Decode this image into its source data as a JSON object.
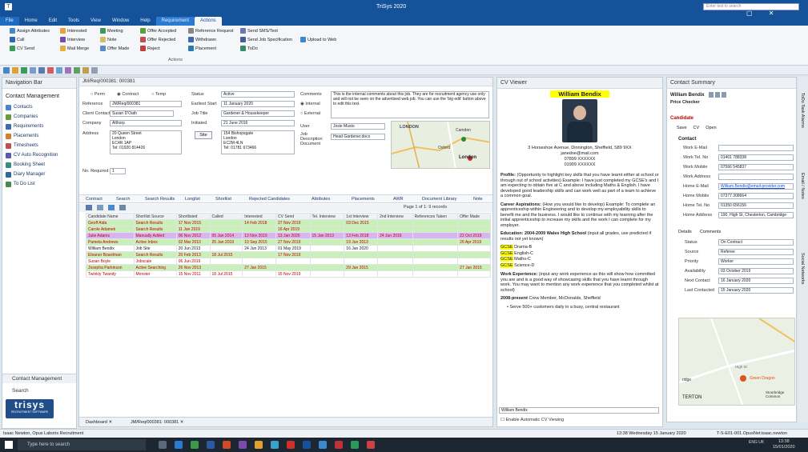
{
  "window": {
    "title": "TriSys 2020",
    "search_placeholder": "Enter text to search"
  },
  "ribbon_tabs": [
    "File",
    "Home",
    "Edit",
    "Tools",
    "View",
    "Window",
    "Help",
    "Requirement",
    "Actions"
  ],
  "ribbon": {
    "group_label": "Actions",
    "buttons": [
      "Assign Attributes",
      "Interested",
      "Meeting",
      "Offer Accepted",
      "Reference Request",
      "Send SMS/Text",
      "Call",
      "Interview",
      "Note",
      "Offer Rejected",
      "Withdrawn",
      "Send Job Specification",
      "Upload to Web",
      "CV Send",
      "Mail Merge",
      "Offer Made",
      "Reject",
      "Placement",
      "ToDo"
    ]
  },
  "nav": {
    "title": "Navigation Bar",
    "section": "Contact Management",
    "items": [
      "Contacts",
      "Companies",
      "Requirements",
      "Placements",
      "Timesheets",
      "CV Auto Recognition",
      "Booking Sheet",
      "Diary Manager",
      "To Do List"
    ],
    "bottom_items": [
      "Contact Management",
      "Search"
    ],
    "logo": "trisys",
    "logo_sub": "RECRUITMENT SOFTWARE"
  },
  "req": {
    "tab_title": "JM/Req/000381: 000381",
    "type_options": [
      "Perm",
      "Contract",
      "Temp"
    ],
    "labels": {
      "reference": "Reference",
      "client_contact": "Client Contact",
      "company": "Company",
      "address": "Address",
      "no_required": "No. Required",
      "status": "Status",
      "earliest_start": "Earliest Start",
      "job_title": "Job Title",
      "initiated": "Initiated",
      "site": "Site",
      "comments": "Comments",
      "user": "User",
      "job_description": "Job Description Document"
    },
    "reference": "JM/Req/000381",
    "client_contact": "Susan D'Oath",
    "company": "Althorp",
    "address": [
      "20 Queen Street",
      "London",
      "EC4R 1AP",
      "Tel: 01920 814426"
    ],
    "no_required": "1",
    "status": "Active",
    "earliest_start": "11 January 2020",
    "job_title": "Gardener & Housekeeper",
    "initiated": "21 June 2016",
    "site_address": [
      "154 Bishopsgate",
      "London",
      "EC2M 4LN",
      "Tel: 01781 673466"
    ],
    "comments": "This is the internal comments about this job. They are for recruitment agency use only and will not be seen on the advertised web job. You can use the 'big edit' button above to edit this text.",
    "comment_options": [
      "Internal",
      "External"
    ],
    "user": "Josie Musto",
    "job_doc": "Head Gardener.docx",
    "map_labels": [
      "LONDON",
      "Camden",
      "Oxford",
      "London"
    ]
  },
  "subtabs": [
    "Contract",
    "Search",
    "Search Results",
    "Longlist",
    "Shortlist",
    "Rejected Candidates",
    "Attributes",
    "Placements",
    "AWR",
    "Document Library",
    "Note"
  ],
  "grid": {
    "page_info": "Page 1 of 1: 9 records",
    "columns": [
      "Candidate Name",
      "Shortlist Source",
      "Shortlisted",
      "Called",
      "Interested",
      "CV Send",
      "Tel. Interview",
      "1st Interview",
      "2nd Interview",
      "References Taken",
      "Offer Made"
    ],
    "rows": [
      {
        "cells": [
          "Geoff Aida",
          "Search Results",
          "17 Nov 2015",
          "",
          "14 Feb 2018",
          "27 Nov 2019",
          "",
          "03 Dec 2015",
          "",
          "",
          ""
        ],
        "bg": "#c9f0b8",
        "fg": "#c00000"
      },
      {
        "cells": [
          "Carole Adamek",
          "Search Results",
          "11 Jan 2019",
          "",
          "",
          "16 Apr 2019",
          "",
          "",
          "",
          "",
          ""
        ],
        "bg": "#c9f0b8",
        "fg": "#c00000"
      },
      {
        "cells": [
          "Julie Adams",
          "Manually Added",
          "06 Nov 2012",
          "05 Jan 2014",
          "13 Nov 2019",
          "13 Jan 2020",
          "15 Jan 2013",
          "13 Feb 2018",
          "24 Jun 2016",
          "",
          "22 Oct 2019"
        ],
        "bg": "#d8b4f0",
        "fg": "#c00000"
      },
      {
        "cells": [
          "Pamela Andrews",
          "Active Inbox",
          "02 Mar 2010",
          "25 Jan 2019",
          "10 Sep 2015",
          "27 Nov 2019",
          "",
          "19 Jun 2013",
          "",
          "",
          "26 Apr 2019"
        ],
        "bg": "#c9f0b8",
        "fg": "#c00000"
      },
      {
        "cells": [
          "William Bendix",
          "Job Site",
          "20 Jun 2013",
          "",
          "24 Jun 2013",
          "01 May 2019",
          "",
          "16 Jan 2020",
          "",
          "",
          ""
        ],
        "bg": "#ffffff",
        "fg": "#1a1a1a"
      },
      {
        "cells": [
          "Eleanor Boardman",
          "Search Results",
          "20 Feb 2013",
          "18 Jul 2015",
          "",
          "17 Nov 2019",
          "",
          "",
          "",
          "",
          ""
        ],
        "bg": "#c9f0b8",
        "fg": "#c00000"
      },
      {
        "cells": [
          "Susan Boyle",
          "Jobscale",
          "06 Jun 2019",
          "",
          "",
          "",
          "",
          "",
          "",
          "",
          ""
        ],
        "bg": "#ffffff",
        "fg": "#c00000"
      },
      {
        "cells": [
          "Josepha Parkinson",
          "Active Searching",
          "26 Nov 2013",
          "",
          "27 Jan 2015",
          "",
          "",
          "29 Jan 2015",
          "",
          "",
          "27 Jan 2015"
        ],
        "bg": "#c9f0b8",
        "fg": "#c00000"
      },
      {
        "cells": [
          "Twinkly Twandy",
          "Monster",
          "15 Nov 2011",
          "18 Jul 2015",
          "",
          "15 Nov 2019",
          "",
          "",
          "",
          "",
          ""
        ],
        "bg": "#ffffff",
        "fg": "#c00000"
      }
    ]
  },
  "doc_tabs": [
    "Dashboard",
    "JM/Req/000381: 000381"
  ],
  "cv": {
    "title": "CV Viewer",
    "name": "William Bendix",
    "address": "3 Horseshoe Avenue, Dinnington, Sheffield, S89 9XX",
    "email": "janedoe@mail.com",
    "phone1": "07899 XXXXXX",
    "phone2": "01909 XXXXXX",
    "profile_label": "Profile:",
    "profile": "(Opportunity to highlight key skills that you have learnt either at school or through out of school activities) Example: I have just completed my GCSE's and I am expecting to obtain five at C and above including Maths & English. I have developed good leadership skills and can work well as part of a team to achieve a common goal.",
    "career_label": "Career Aspirations:",
    "career": "(How you would like to develop) Example: To complete an apprenticeship within Engineering and to develop my employability skills to benefit me and the business. I would like to continue with my learning after the initial apprenticeship to increase my skills and the work I can complete for my employer.",
    "education_label": "Education: 2004-2009 Wales High School",
    "education": "(input all grades, use predicted if results not yet known)",
    "gcse_prefix": "GCSE",
    "grades": [
      " Drama-B",
      " English-C",
      " Maths-C",
      " Science-D"
    ],
    "work_label": "Work Experience:",
    "work": "(input any work experience as this will show how committed you are and is a good way of showcasing skills that you have learnt through work. You may want to mention any work experience that you completed whilst at school)",
    "present_label": "2008-present",
    "present": "Crew Member, McDonalds, Sheffield",
    "bullet": "Serve 500+ customers daily in a busy, central restaurant",
    "footer_name": "William Bendix",
    "auto_label": "Enable Automatic CV Viewing"
  },
  "summary": {
    "title": "Contact Summary",
    "name": "William Bendix",
    "job": "Price Checker",
    "type": "Candidate",
    "actions": [
      "Save",
      "CV",
      "Open"
    ],
    "contact_label": "Contact",
    "field_labels": [
      "Work E-Mail",
      "Work Tel. No",
      "Work Mobile",
      "Work Address",
      "Home E-Mail",
      "Home Mobile",
      "Home Tel. No",
      "Home Address"
    ],
    "field_values": [
      "",
      "01401 788338",
      "07566 545837",
      "",
      "William.Bendix@email-provider.com",
      "07377 308664",
      "01350 656156",
      "190, High St, Chesterton, Cambridge"
    ],
    "detail_tabs": [
      "Details",
      "Comments"
    ],
    "detail_labels": [
      "Status",
      "Source",
      "Priority",
      "Availability",
      "Next Contact",
      "Last Contacted"
    ],
    "detail_values": [
      "On Contract",
      "Referee",
      "Worker",
      "03 October 2019",
      "16 January 2020",
      "15 January 2020"
    ],
    "map_labels": [
      "Green Dragon",
      "High St",
      "Stourbridge Common",
      "TERTON",
      "ridge"
    ]
  },
  "side_tabs": [
    "ToDo Task Alarms",
    "Email / Notes",
    "Social Networks"
  ],
  "statusbar": {
    "left": "Isaac Newton, Opus Laboris Recruitment",
    "time": "13:38 Wednesday 15 January 2020",
    "server": "T-S-E01-001.OpusNet:isaac.newton"
  },
  "taskbar": {
    "search": "Type here to search",
    "lang": "ENG UK",
    "time": "13:38",
    "date": "15/01/2020"
  }
}
